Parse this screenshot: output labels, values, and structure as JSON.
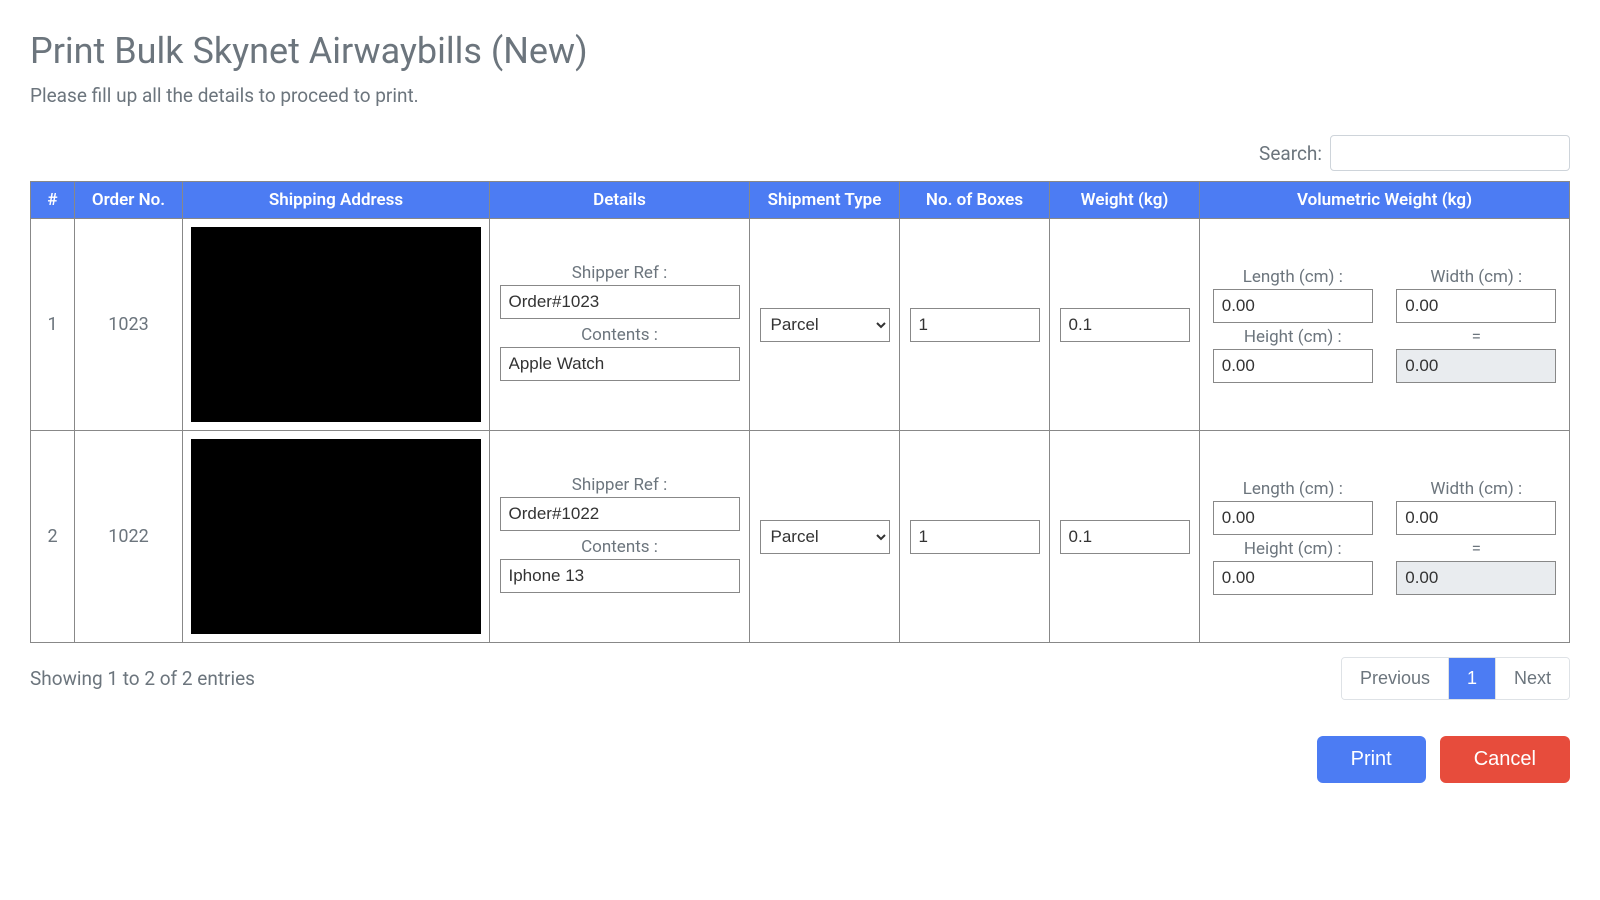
{
  "page": {
    "title": "Print Bulk Skynet Airwaybills (New)",
    "subtitle": "Please fill up all the details to proceed to print."
  },
  "search": {
    "label": "Search:",
    "value": ""
  },
  "table": {
    "headers": {
      "index": "#",
      "order_no": "Order No.",
      "shipping_address": "Shipping Address",
      "details": "Details",
      "shipment_type": "Shipment Type",
      "boxes": "No. of Boxes",
      "weight": "Weight (kg)",
      "vol_weight": "Volumetric Weight (kg)"
    },
    "labels": {
      "shipper_ref": "Shipper Ref :",
      "contents": "Contents :",
      "length": "Length (cm) :",
      "width": "Width (cm) :",
      "height": "Height (cm) :",
      "equals": "="
    },
    "shipment_options": [
      "Parcel"
    ],
    "rows": [
      {
        "index": "1",
        "order_no": "1023",
        "shipper_ref": "Order#1023",
        "contents": "Apple Watch",
        "shipment_type": "Parcel",
        "boxes": "1",
        "weight": "0.1",
        "length": "0.00",
        "width": "0.00",
        "height": "0.00",
        "vol_result": "0.00"
      },
      {
        "index": "2",
        "order_no": "1022",
        "shipper_ref": "Order#1022",
        "contents": "Iphone 13",
        "shipment_type": "Parcel",
        "boxes": "1",
        "weight": "0.1",
        "length": "0.00",
        "width": "0.00",
        "height": "0.00",
        "vol_result": "0.00"
      }
    ]
  },
  "footer": {
    "entries_text": "Showing 1 to 2 of 2 entries",
    "pager": {
      "prev": "Previous",
      "page1": "1",
      "next": "Next"
    },
    "buttons": {
      "print": "Print",
      "cancel": "Cancel"
    }
  }
}
